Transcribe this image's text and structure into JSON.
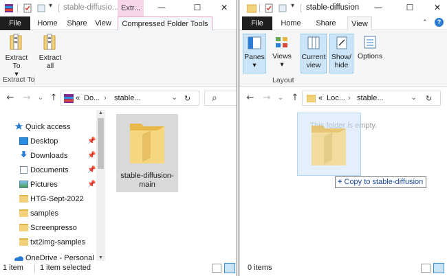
{
  "left_window": {
    "title": "stable-diffusio...",
    "context_tab": "Extr...",
    "caption": {
      "minimize": "—",
      "maximize": "☐",
      "close": "✕"
    },
    "menu": {
      "file": "File",
      "home": "Home",
      "share": "Share",
      "view": "View",
      "context": "Compressed Folder Tools"
    },
    "ribbon": {
      "extract_to": "Extract To",
      "extract_to_arrow": "▾",
      "extract_all_1": "Extract",
      "extract_all_2": "all",
      "group_label": "Extract To"
    },
    "address": {
      "prefix": "«",
      "crumb1": "Do...",
      "crumb2": "stable...",
      "chevron": "›",
      "dropdown": "⌄",
      "refresh": "↻",
      "search_icon": "⌕"
    },
    "nav": {
      "quick_access": "Quick access",
      "items": [
        {
          "label": "Desktop",
          "pinned": "📌"
        },
        {
          "label": "Downloads",
          "pinned": "📌"
        },
        {
          "label": "Documents",
          "pinned": "📌"
        },
        {
          "label": "Pictures",
          "pinned": "📌"
        },
        {
          "label": "HTG-Sept-2022"
        },
        {
          "label": "samples"
        },
        {
          "label": "Screenpresso"
        },
        {
          "label": "txt2img-samples"
        }
      ],
      "onedrive": "OneDrive - Personal"
    },
    "content": {
      "folder_name_1": "stable-diffusion-",
      "folder_name_2": "main"
    },
    "status": {
      "count": "1 item",
      "selected": "1 item selected"
    }
  },
  "right_window": {
    "title": "stable-diffusion",
    "caption": {
      "minimize": "—",
      "maximize": "☐",
      "close": "✕"
    },
    "menu": {
      "file": "File",
      "home": "Home",
      "share": "Share",
      "view": "View"
    },
    "ribbon": {
      "panes": "Panes",
      "views": "Views",
      "current_view_1": "Current",
      "current_view_2": "view",
      "show_hide_1": "Show/",
      "show_hide_2": "hide",
      "options": "Options",
      "layout_label": "Layout",
      "arrow": "▾"
    },
    "address": {
      "prefix": "«",
      "crumb1": "Loc...",
      "crumb2": "stable...",
      "chevron": "›",
      "dropdown": "⌄",
      "refresh": "↻"
    },
    "content": {
      "empty_text": "This folder is empty."
    },
    "status": {
      "count": "0 items"
    }
  },
  "drag": {
    "tooltip_plus": "+",
    "tooltip_text": "Copy to stable-diffusion"
  },
  "nav_buttons": {
    "back": "←",
    "forward": "→",
    "up": "↑",
    "chevron": "⌄"
  },
  "colors": {
    "file_tab": "#1e1e1e",
    "context_tab": "#f7d5ea",
    "folder": "#f3d17a",
    "selection": "#d9d9d9",
    "link_blue": "#1b4aa6"
  }
}
